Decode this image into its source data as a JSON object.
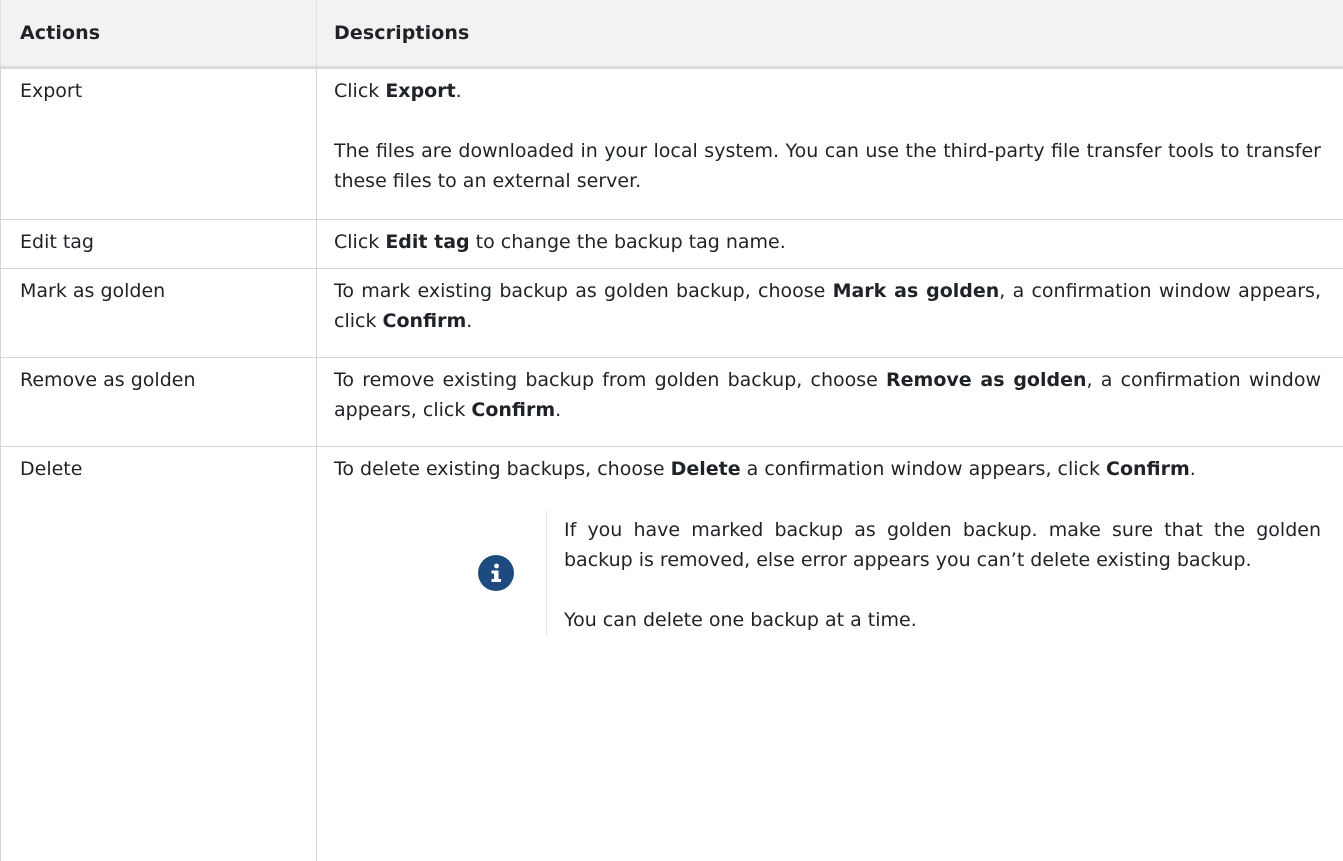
{
  "table": {
    "headers": {
      "actions": "Actions",
      "descriptions": "Descriptions"
    },
    "rows": {
      "export": {
        "action": "Export",
        "line1": {
          "pre": "Click ",
          "b1": "Export",
          "post": "."
        },
        "line2": "The files are downloaded in your local system. You can use the third-party file transfer tools to transfer these files to an external server."
      },
      "edit": {
        "action": "Edit tag",
        "pre": "Click ",
        "b1": "Edit tag",
        "post": " to change the backup tag name."
      },
      "mark": {
        "action": "Mark as golden",
        "pre": "To mark existing backup as golden backup, choose ",
        "b1": "Mark as golden",
        "mid": ", a confirmation window appears, click ",
        "b2": "Confirm",
        "post": "."
      },
      "remove": {
        "action": "Remove as golden",
        "pre": "To remove existing backup from golden backup, choose ",
        "b1": "Remove as golden",
        "mid": ", a confirmation window appears, click ",
        "b2": "Confirm",
        "post": "."
      },
      "delete": {
        "action": "Delete",
        "pre": "To delete existing backups, choose ",
        "b1": "Delete",
        "mid": " a confirmation window appears, click ",
        "b2": "Confirm",
        "post": ".",
        "note": {
          "icon": "info-icon",
          "line1": "If you have marked backup as golden backup. make sure that the golden backup is removed, else error appears you can’t delete existing backup.",
          "line2": "You can delete one backup at a time."
        }
      }
    }
  },
  "colors": {
    "header_bg": "#f2f2f2",
    "border": "#d4d4d4",
    "text": "#1f2226",
    "info_icon": "#1d4b7f"
  }
}
